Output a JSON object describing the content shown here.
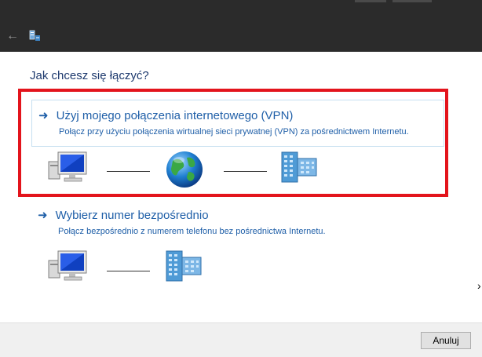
{
  "header": {
    "back_icon": "back-arrow-icon",
    "app_icon": "network-connection-icon"
  },
  "main": {
    "heading": "Jak chcesz się łączyć?",
    "options": [
      {
        "title": "Użyj mojego połączenia internetowego (VPN)",
        "description": "Połącz przy użyciu połączenia wirtualnej sieci prywatnej (VPN) za pośrednictwem Internetu.",
        "icons": [
          "computer-icon",
          "globe-icon",
          "server-icon"
        ]
      },
      {
        "title": "Wybierz numer bezpośrednio",
        "description": "Połącz bezpośrednio z numerem telefonu bez pośrednictwa Internetu.",
        "icons": [
          "computer-icon",
          "server-icon"
        ]
      }
    ],
    "highlight_color": "#e3141c",
    "link_color": "#1f5fa8"
  },
  "footer": {
    "cancel_label": "Anuluj"
  }
}
